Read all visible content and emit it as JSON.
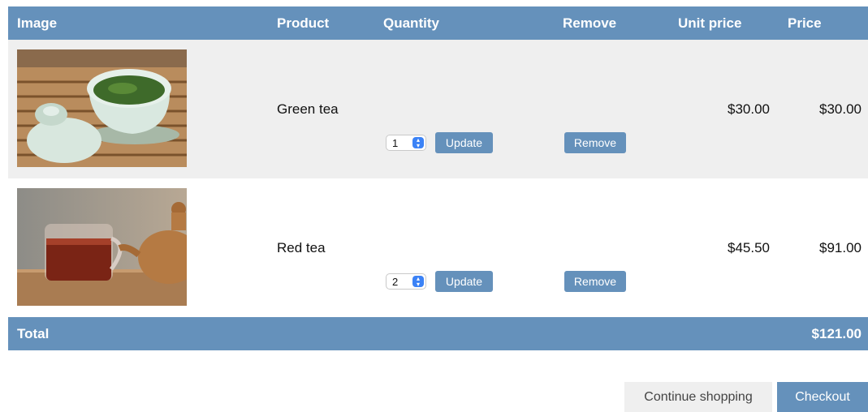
{
  "header": {
    "image": "Image",
    "product": "Product",
    "quantity": "Quantity",
    "remove": "Remove",
    "unit_price": "Unit price",
    "price": "Price"
  },
  "items": [
    {
      "product": "Green tea",
      "quantity": "1",
      "update_label": "Update",
      "remove_label": "Remove",
      "unit_price": "$30.00",
      "price": "$30.00"
    },
    {
      "product": "Red tea",
      "quantity": "2",
      "update_label": "Update",
      "remove_label": "Remove",
      "unit_price": "$45.50",
      "price": "$91.00"
    }
  ],
  "total": {
    "label": "Total",
    "value": "$121.00"
  },
  "actions": {
    "continue": "Continue shopping",
    "checkout": "Checkout"
  },
  "colors": {
    "accent": "#6591bb",
    "row_alt": "#efefef",
    "stepper": "#3b82f6"
  }
}
